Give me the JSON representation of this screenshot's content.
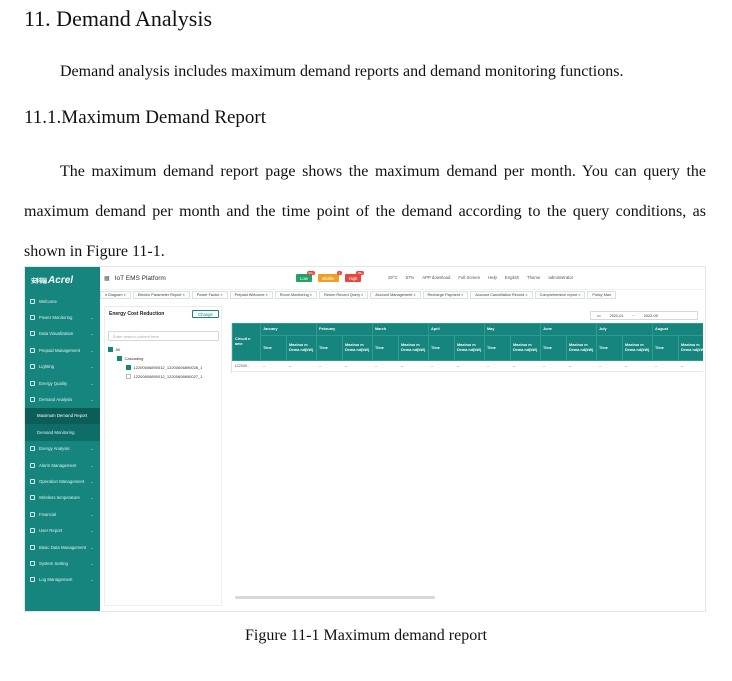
{
  "document": {
    "heading": "11. Demand Analysis",
    "intro": "Demand analysis includes maximum demand reports and demand monitoring functions.",
    "subheading": "11.1.Maximum Demand Report",
    "paragraph": "The maximum demand report page shows the maximum demand per month. You can query the maximum demand per month and the time point of the demand according to the query conditions, as shown in Figure 11-1.",
    "caption": "Figure 11-1 Maximum demand report"
  },
  "app": {
    "logo": "Acrel",
    "logo_mark": "安科瑞",
    "title": "IoT EMS Platform",
    "accent": "#15857d",
    "badges": [
      {
        "label": "Low",
        "count": "99+",
        "color": "#21a366"
      },
      {
        "label": "Middle",
        "count": "1",
        "color": "#f0a020"
      },
      {
        "label": "High",
        "count": "99+",
        "color": "#e8463c"
      }
    ],
    "topbar": [
      "29°C",
      "57%",
      "APP download",
      "Full Screen",
      "Help",
      "English",
      "Theme",
      "administrator"
    ],
    "sidebar": [
      {
        "label": "Welcome",
        "icon": "monitor-icon"
      },
      {
        "label": "Power Monitoring",
        "icon": "power-icon"
      },
      {
        "label": "Data Visualization",
        "icon": "chart-icon"
      },
      {
        "label": "Prepaid Management",
        "icon": "prepaid-icon"
      },
      {
        "label": "Lighting",
        "icon": "bulb-icon"
      },
      {
        "label": "Energy Quality",
        "icon": "quality-icon"
      },
      {
        "label": "Demand Analysis",
        "icon": "demand-icon"
      },
      {
        "label": "Maximum Demand Report",
        "icon": "",
        "sub": true,
        "active": true
      },
      {
        "label": "Demand Monitoring",
        "icon": "",
        "sub": true
      },
      {
        "label": "Energy Analysis",
        "icon": "analysis-icon"
      },
      {
        "label": "Alarm Management",
        "icon": "alarm-icon"
      },
      {
        "label": "Operation Management",
        "icon": "wrench-icon"
      },
      {
        "label": "Wireless temperature",
        "icon": "thermometer-icon"
      },
      {
        "label": "Financial",
        "icon": "finance-icon"
      },
      {
        "label": "User Report",
        "icon": "report-icon"
      },
      {
        "label": "Basic Data Management",
        "icon": "database-icon"
      },
      {
        "label": "System Setting",
        "icon": "gear-icon"
      },
      {
        "label": "Log Management",
        "icon": "log-icon"
      }
    ],
    "tabs": [
      "n Diagram ×",
      "Electric Parameter Report ×",
      "Power Factor ×",
      "Prepaid Welcome ×",
      "Room Monitoring ×",
      "Return Record Query ×",
      "Account Management ×",
      "Recharge Payment ×",
      "Account Cancellation Record ×",
      "Comprehensive report ×",
      "Policy Man"
    ],
    "panel": {
      "title": "Energy Cost Reduction",
      "change_button": "Change",
      "search_placeholder": "Enter search content here",
      "tree": [
        {
          "label": "All",
          "checked": true,
          "level": 0
        },
        {
          "label": "Cascading",
          "checked": true,
          "level": 1
        },
        {
          "label": "12200606890012_12200606890028_1",
          "checked": true,
          "level": 2
        },
        {
          "label": "12200606890012_12200606890027_1",
          "checked": false,
          "level": 2
        }
      ]
    },
    "date_range": {
      "start": "2022-01",
      "separator": "~",
      "end": "2022-09"
    },
    "table": {
      "first_col": "Circuit n ame",
      "months": [
        "January",
        "February",
        "March",
        "April",
        "May",
        "June",
        "July",
        "August"
      ],
      "sub_headers": [
        "Time",
        "Maximu m Dema nd(kW)"
      ],
      "last_partial": "Ma m D nd(",
      "rows": [
        {
          "name": "122000...",
          "cells": [
            "--",
            "--",
            "--",
            "--",
            "--",
            "--",
            "--",
            "--",
            "--",
            "--",
            "--",
            "--",
            "--",
            "--",
            "--",
            "--"
          ]
        }
      ]
    }
  }
}
